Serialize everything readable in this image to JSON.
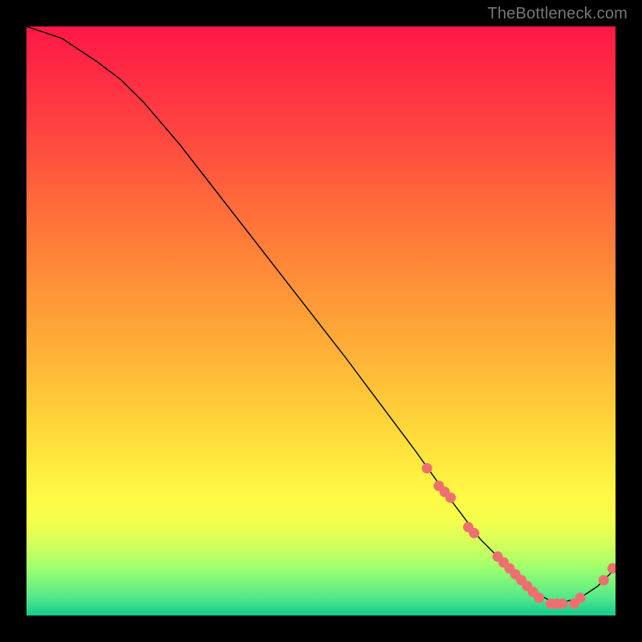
{
  "attribution": "TheBottleneck.com",
  "colors": {
    "background": "#000000",
    "attribution_text": "#777777",
    "line": "#000000",
    "marker": "#ed7070",
    "gradient_top": "#ff1846",
    "gradient_bottom": "#12c98d"
  },
  "chart_data": {
    "type": "line",
    "title": "",
    "xlabel": "",
    "ylabel": "",
    "xlim": [
      0,
      100
    ],
    "ylim": [
      0,
      100
    ],
    "grid": false,
    "legend": false,
    "series": [
      {
        "name": "curve",
        "x": [
          0,
          3,
          6,
          9,
          12,
          16,
          20,
          26,
          33,
          40,
          47,
          54,
          60,
          66,
          71,
          74,
          77,
          80,
          83,
          86,
          90,
          94,
          97,
          100
        ],
        "y": [
          100,
          99,
          98,
          96,
          94,
          91,
          87,
          80,
          71,
          62,
          53,
          44,
          36,
          28,
          21,
          17,
          13,
          10,
          7,
          4,
          2,
          3,
          5,
          8
        ]
      }
    ],
    "markers": {
      "name": "highlight-points",
      "x": [
        68,
        70,
        71,
        72,
        75,
        76,
        80,
        81,
        82,
        83,
        84,
        85,
        86,
        87,
        89,
        90,
        91,
        93,
        94,
        98,
        99.5
      ],
      "y": [
        25,
        22,
        21,
        20,
        15,
        14,
        10,
        9,
        8,
        7,
        6,
        5,
        4,
        3,
        2,
        2,
        2,
        2,
        3,
        6,
        8
      ]
    }
  }
}
